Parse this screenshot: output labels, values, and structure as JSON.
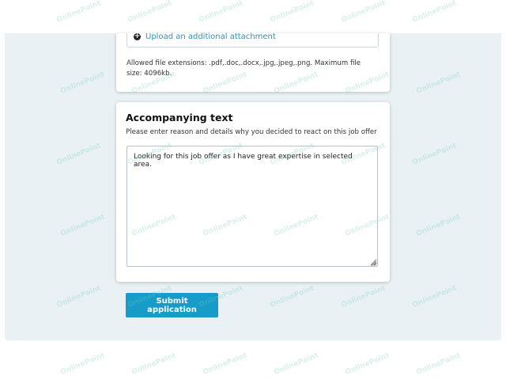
{
  "upload": {
    "add_attachment_label": "Upload an additional attachment",
    "allowed_text": "Allowed file extensions: .pdf,.doc,.docx,.jpg,.jpeg,.png. Maximum file size: 4096kb."
  },
  "accompanying": {
    "title": "Accompanying text",
    "hint": "Please enter reason and details why you decided to react on this job offer",
    "textarea_value": "Looking for this job offer as I have great expertise in selected area."
  },
  "actions": {
    "submit_label": "Submit application"
  },
  "watermark": {
    "text": "OnlinePoint"
  },
  "colors": {
    "accent": "#179bc8",
    "link": "#2e92b0",
    "page_background": "#e9f1f4"
  }
}
